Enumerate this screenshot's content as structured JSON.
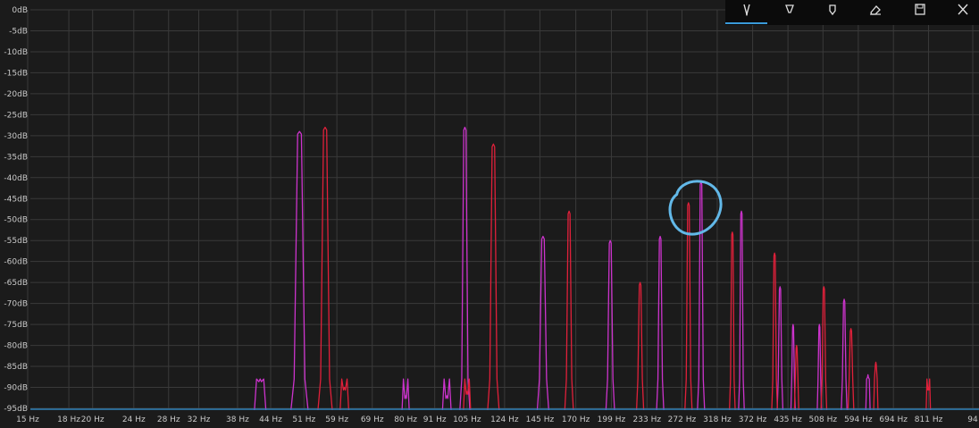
{
  "toolbar": {
    "tools": [
      {
        "name": "pen-icon"
      },
      {
        "name": "highlighter-icon"
      },
      {
        "name": "marker-icon"
      },
      {
        "name": "eraser-icon"
      },
      {
        "name": "save-icon"
      },
      {
        "name": "close-icon"
      }
    ],
    "active_color": "#3a9ad9"
  },
  "annotation": {
    "type": "hand-drawn circle",
    "color": "#62b8e8",
    "around_x_hz": 290,
    "around_db": -47
  },
  "chart_data": {
    "type": "line",
    "x_scale": "log",
    "x_ticks": [
      "15 Hz",
      "18 Hz",
      "20 Hz",
      "24 Hz",
      "28 Hz",
      "32 Hz",
      "38 Hz",
      "44 Hz",
      "51 Hz",
      "59 Hz",
      "69 Hz",
      "80 Hz",
      "91 Hz",
      "105 Hz",
      "124 Hz",
      "145 Hz",
      "170 Hz",
      "199 Hz",
      "233 Hz",
      "272 Hz",
      "318 Hz",
      "372 Hz",
      "435 Hz",
      "508 Hz",
      "594 Hz",
      "694 Hz",
      "811 Hz",
      "94"
    ],
    "y_ticks": [
      "0dB",
      "-5dB",
      "-10dB",
      "-15dB",
      "-20dB",
      "-25dB",
      "-30dB",
      "-35dB",
      "-40dB",
      "-45dB",
      "-50dB",
      "-55dB",
      "-60dB",
      "-65dB",
      "-70dB",
      "-75dB",
      "-80dB",
      "-85dB",
      "-90dB",
      "-95dB"
    ],
    "ylim": [
      -95,
      0
    ],
    "grid": true,
    "colors": {
      "background": "#1b1b1b",
      "grid": "#3a3a3a",
      "series_a": "#cc33cc",
      "series_b": "#e0203a",
      "baseline": "#2e7fb8"
    },
    "series": [
      {
        "color": "#cc33cc",
        "peaks": [
          {
            "x": 50,
            "db": -29,
            "hw": 6
          },
          {
            "x": 104,
            "db": -28,
            "hw": 3.5
          },
          {
            "x": 147,
            "db": -54,
            "hw": 4
          },
          {
            "x": 198,
            "db": -55,
            "hw": 3
          },
          {
            "x": 247,
            "db": -54,
            "hw": 2.5
          },
          {
            "x": 296,
            "db": -41,
            "hw": 2.5
          },
          {
            "x": 354,
            "db": -48,
            "hw": 2
          },
          {
            "x": 420,
            "db": -66,
            "hw": 2
          },
          {
            "x": 445,
            "db": -75,
            "hw": 1.5
          },
          {
            "x": 500,
            "db": -75,
            "hw": 1.5
          },
          {
            "x": 558,
            "db": -69,
            "hw": 2
          },
          {
            "x": 620,
            "db": -87,
            "hw": 1.5
          }
        ],
        "extra_lobes": [
          {
            "x": 42,
            "db": -88,
            "hw": 4
          },
          {
            "x": 80,
            "db": -92,
            "hw": 2.5
          },
          {
            "x": 96,
            "db": -92,
            "hw": 3
          }
        ]
      },
      {
        "color": "#e0203a",
        "peaks": [
          {
            "x": 56,
            "db": -28,
            "hw": 5
          },
          {
            "x": 118,
            "db": -32,
            "hw": 4
          },
          {
            "x": 165,
            "db": -48,
            "hw": 3
          },
          {
            "x": 226,
            "db": -65,
            "hw": 2.5
          },
          {
            "x": 280,
            "db": -46,
            "hw": 2.5
          },
          {
            "x": 340,
            "db": -53,
            "hw": 2
          },
          {
            "x": 410,
            "db": -58,
            "hw": 2
          },
          {
            "x": 452,
            "db": -80,
            "hw": 1.5
          },
          {
            "x": 510,
            "db": -66,
            "hw": 2
          },
          {
            "x": 575,
            "db": -76,
            "hw": 2
          },
          {
            "x": 642,
            "db": -84,
            "hw": 1.5
          },
          {
            "x": 810,
            "db": -90,
            "hw": 1.5
          }
        ],
        "extra_lobes": [
          {
            "x": 61,
            "db": -90,
            "hw": 3
          },
          {
            "x": 105,
            "db": -91,
            "hw": 2.5
          }
        ]
      }
    ]
  }
}
